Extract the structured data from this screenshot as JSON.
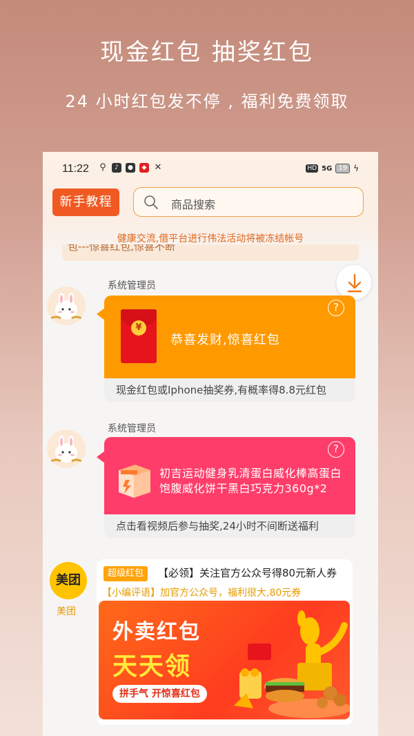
{
  "promo": {
    "title": "现金红包 抽奖红包",
    "subtitle": "24 小时红包发不停 , 福利免费领取"
  },
  "status_bar": {
    "time": "11:22",
    "battery": "19",
    "network": "5G",
    "hd": "HD"
  },
  "header": {
    "tutorial_label": "新手教程",
    "search_placeholder": "商品搜索"
  },
  "notice": "健康交流,借平台进行伟法活动将被冻结帐号",
  "banner_strip_text": "包---惊喜红包,惊喜不断",
  "messages": [
    {
      "sender": "系统管理员",
      "card_title": "恭喜发财,惊喜红包",
      "footer": "现金红包或Iphone抽奖券,有概率得8.8元红包",
      "help": "?"
    },
    {
      "sender": "系统管理员",
      "card_title": "初吉运动健身乳清蛋白威化棒高蛋白饱腹威化饼干黑白巧克力360g*2",
      "footer": "点击看视频后参与抽奖,24小时不间断送福利",
      "help": "?"
    }
  ],
  "meituan": {
    "logo_text": "美团",
    "label": "美团",
    "tag": "超级红包",
    "headline": "【必领】关注官方公众号得80元新人券",
    "comment": "【小编评语】加官方公众号，福利很大,80元券",
    "banner_line1": "外卖红包",
    "banner_line2": "天天领",
    "banner_cta": "拼手气 开惊喜红包"
  },
  "colors": {
    "accent_orange": "#f05a22",
    "card_orange": "#ff9900",
    "card_pink": "#ff3d6a",
    "meituan_yellow": "#ffc300"
  }
}
